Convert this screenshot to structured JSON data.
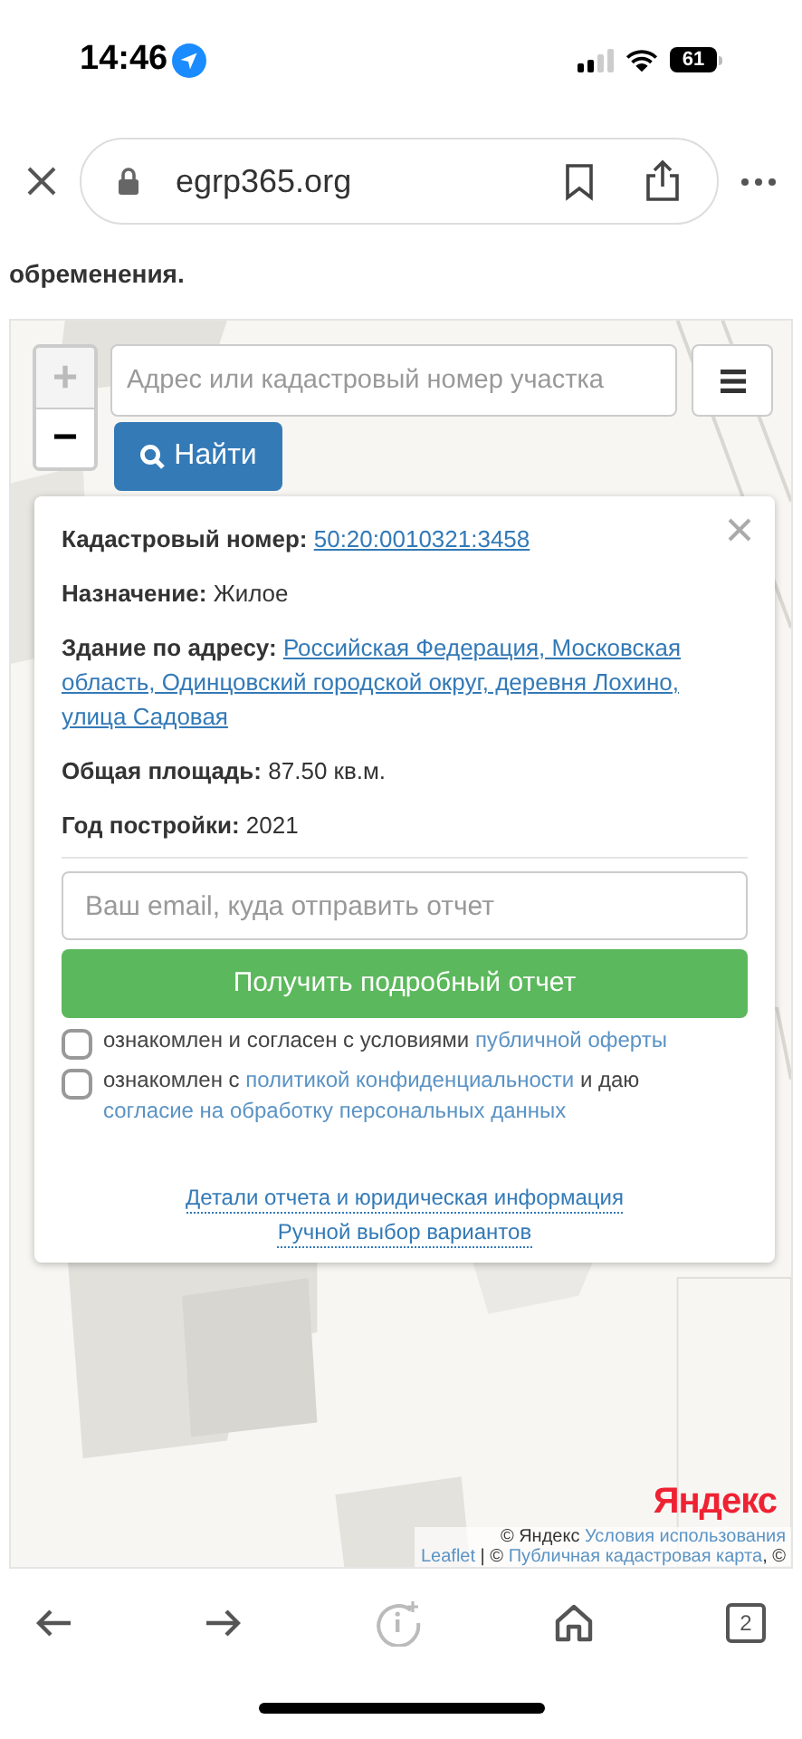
{
  "status_bar": {
    "time": "14:46",
    "battery": "61"
  },
  "browser": {
    "url": "egrp365.org"
  },
  "page_text": "обременения.",
  "map": {
    "zoom": [
      {
        "label": "+",
        "disabled": true
      },
      {
        "label": "−",
        "disabled": false
      }
    ],
    "search": {
      "placeholder": "Адрес или кадастровый номер участка"
    },
    "find_button": "Найти",
    "popup": {
      "fields": [
        {
          "label": "Кадастровый номер:",
          "value": "50:20:0010321:3458",
          "link": true
        },
        {
          "label": "Назначение:",
          "value": "Жилое",
          "link": false
        },
        {
          "label": "Здание по адресу:",
          "value": "Российская Федерация, Московская область, Одинцовский городской округ, деревня Лохино, улица Садовая",
          "link": true
        },
        {
          "label": "Общая площадь:",
          "value": "87.50 кв.м.",
          "link": false
        },
        {
          "label": "Год постройки:",
          "value": "2021",
          "link": false
        }
      ],
      "email": {
        "placeholder": "Ваш email, куда отправить отчет"
      },
      "submit": "Получить подробный отчет",
      "consents": [
        {
          "checked": false,
          "parts": [
            {
              "text": "ознакомлен и согласен с условиями ",
              "link": false
            },
            {
              "text": "публичной оферты",
              "link": true
            }
          ]
        },
        {
          "checked": false,
          "parts": [
            {
              "text": "ознакомлен с ",
              "link": false
            },
            {
              "text": "политикой конфиденциальности",
              "link": true
            },
            {
              "text": " и даю ",
              "link": false
            },
            {
              "text": "согласие на обработку персональных данных",
              "link": true
            }
          ]
        }
      ],
      "links": [
        "Детали отчета и юридическая информация",
        "Ручной выбор вариантов"
      ]
    },
    "logo": "Яндекс",
    "attribution": [
      [
        {
          "text": "© Яндекс ",
          "link": false
        },
        {
          "text": "Условия использования",
          "link": true
        }
      ],
      [
        {
          "text": "Leaflet",
          "link": true
        },
        {
          "text": " | © ",
          "link": false
        },
        {
          "text": "Публичная кадастровая карта",
          "link": true
        },
        {
          "text": ", ©",
          "link": false
        }
      ]
    ]
  },
  "toolbar": {
    "tabs": "2"
  }
}
